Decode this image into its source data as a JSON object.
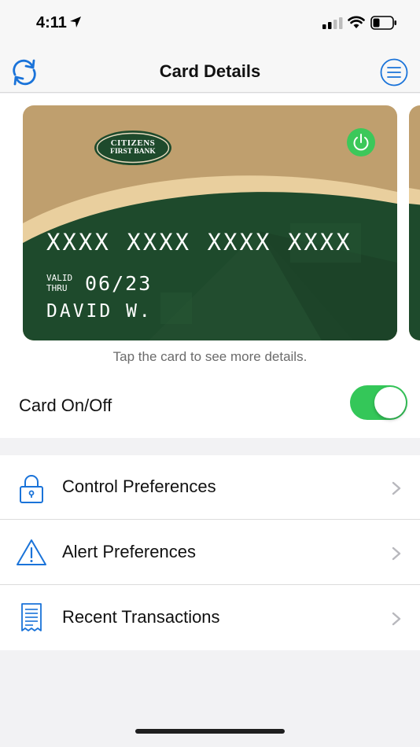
{
  "status_bar": {
    "time": "4:11",
    "icons": [
      "location-arrow-icon",
      "cellular-signal-icon",
      "wifi-icon",
      "battery-icon"
    ]
  },
  "nav": {
    "title": "Card Details",
    "left_icon": "refresh-icon",
    "right_icon": "menu-icon"
  },
  "card": {
    "bank_name_line1": "CITIZENS",
    "bank_name_line2": "FIRST BANK",
    "number": "XXXX XXXX XXXX XXXX",
    "valid_label_line1": "VALID",
    "valid_label_line2": "THRU",
    "expiry": "06/23",
    "holder": "DAVID W.",
    "power_icon": "power-icon",
    "colors": {
      "gold": "#bf9f6e",
      "green": "#1e4a2c",
      "cream": "#e9cf9e",
      "power": "#3cc85a"
    }
  },
  "tap_hint": "Tap the card to see more details.",
  "card_toggle": {
    "label": "Card On/Off",
    "on": true,
    "color": "#34c759"
  },
  "menu_items": [
    {
      "label": "Control Preferences",
      "icon": "lock-icon"
    },
    {
      "label": "Alert Preferences",
      "icon": "warning-icon"
    },
    {
      "label": "Recent Transactions",
      "icon": "receipt-icon"
    }
  ],
  "accent_color": "#1a73d9"
}
